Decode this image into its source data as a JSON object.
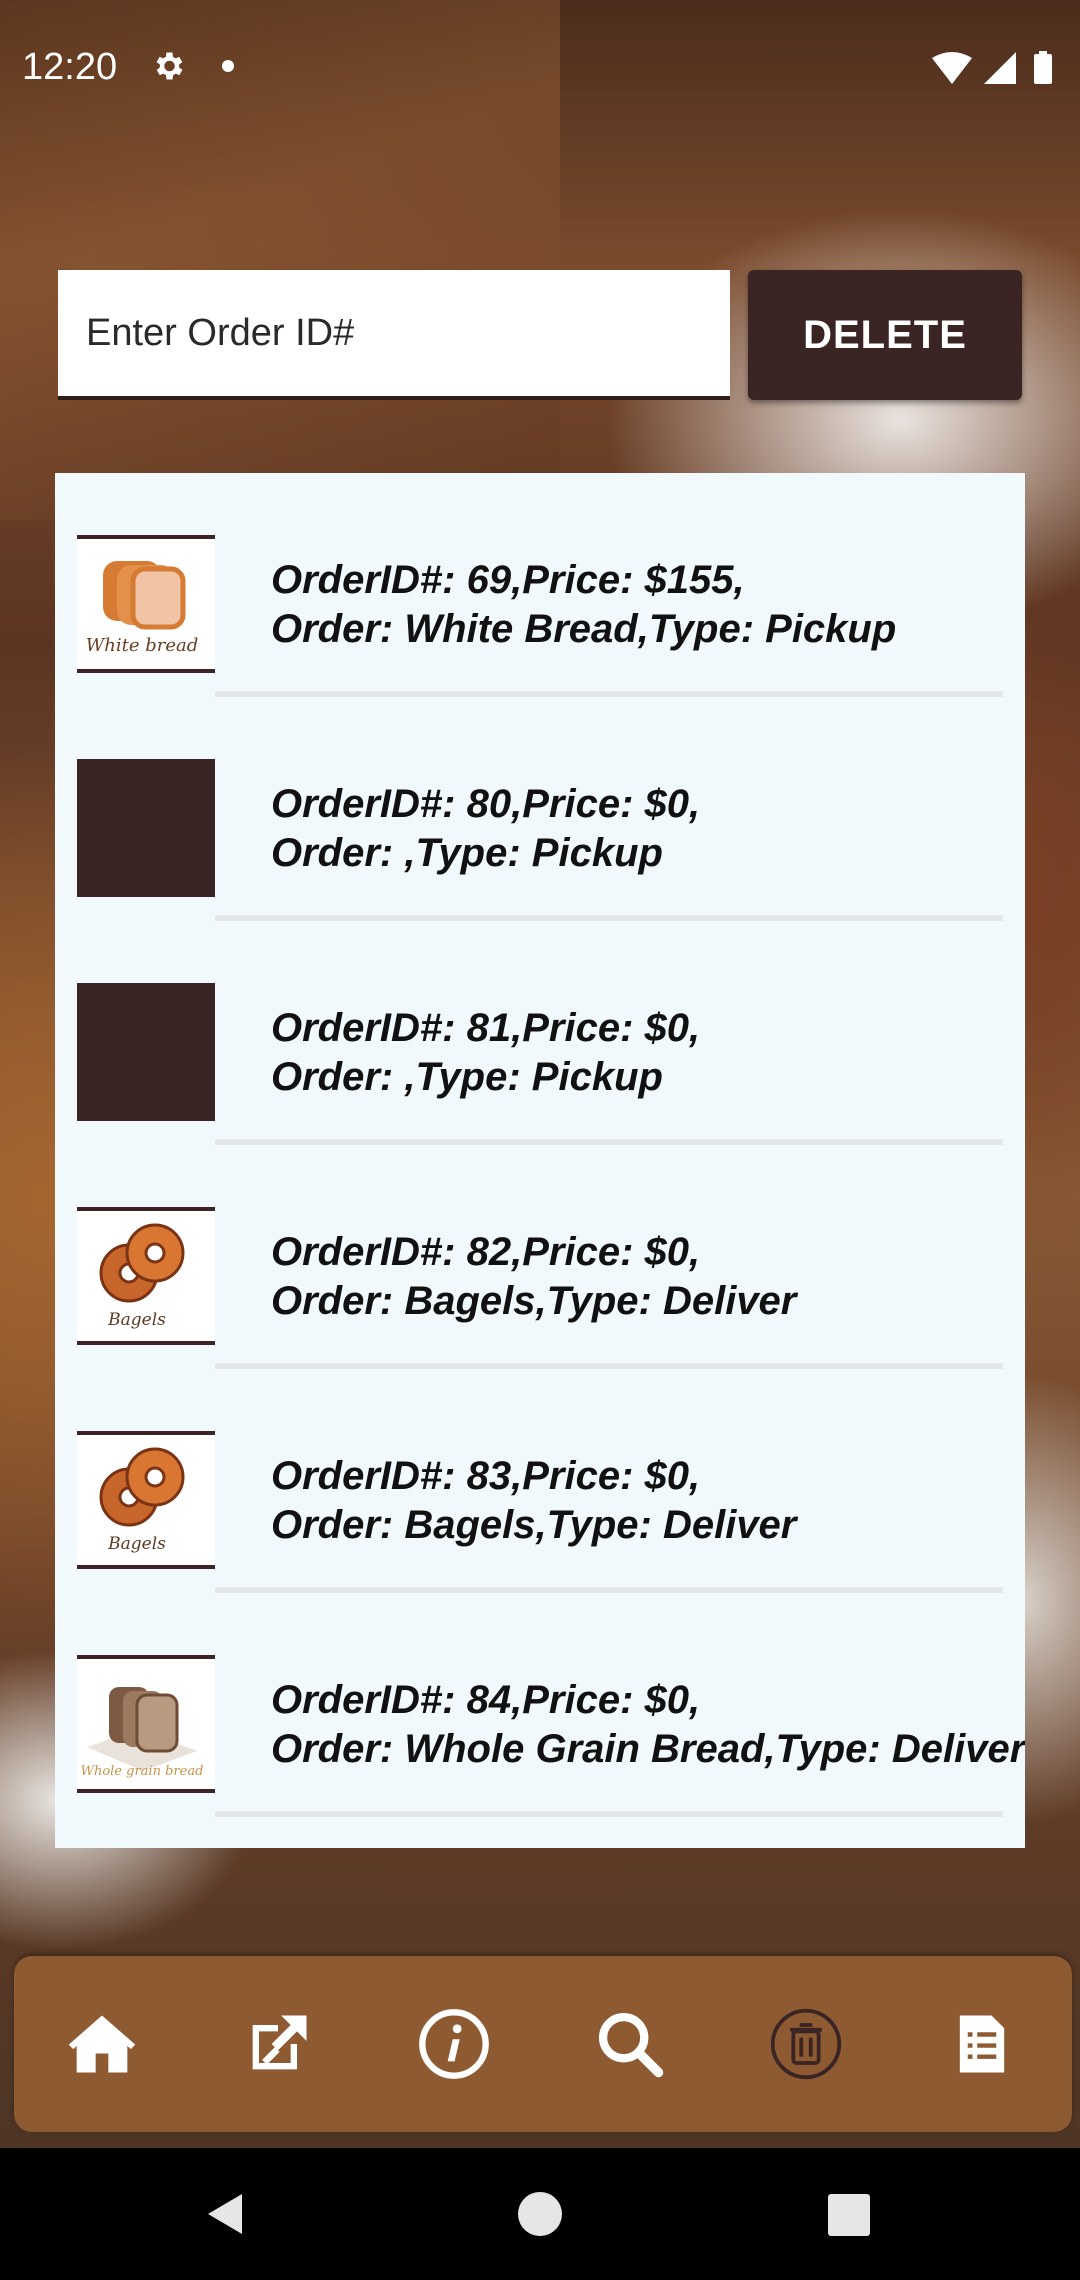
{
  "status_bar": {
    "time": "12:20"
  },
  "search": {
    "placeholder": "Enter Order ID#",
    "value": "",
    "delete_label": "DELETE"
  },
  "orders": [
    {
      "line1": "OrderID#: 69,Price: $155,",
      "line2": "Order: White Bread,Type: Pickup",
      "thumb": "white-bread",
      "caption": "White bread"
    },
    {
      "line1": "OrderID#: 80,Price: $0,",
      "line2": "Order: ,Type: Pickup",
      "thumb": "empty"
    },
    {
      "line1": "OrderID#: 81,Price: $0,",
      "line2": "Order: ,Type: Pickup",
      "thumb": "empty"
    },
    {
      "line1": "OrderID#: 82,Price: $0,",
      "line2": "Order: Bagels,Type: Deliver",
      "thumb": "bagels",
      "caption": "Bagels"
    },
    {
      "line1": "OrderID#: 83,Price: $0,",
      "line2": "Order: Bagels,Type: Deliver",
      "thumb": "bagels",
      "caption": "Bagels"
    },
    {
      "line1": "OrderID#: 84,Price: $0,",
      "line2": "Order: Whole Grain Bread,Type: Deliver",
      "thumb": "whole-grain-bread",
      "caption": "Whole grain bread"
    }
  ],
  "bottom_nav": [
    {
      "icon": "home-icon"
    },
    {
      "icon": "open-external-icon"
    },
    {
      "icon": "info-icon"
    },
    {
      "icon": "search-icon"
    },
    {
      "icon": "trash-icon"
    },
    {
      "icon": "checklist-icon"
    }
  ],
  "colors": {
    "accent_dark": "#3a2424",
    "nav_brown": "#8e5a32",
    "panel_bg": "#f1f9fd"
  }
}
